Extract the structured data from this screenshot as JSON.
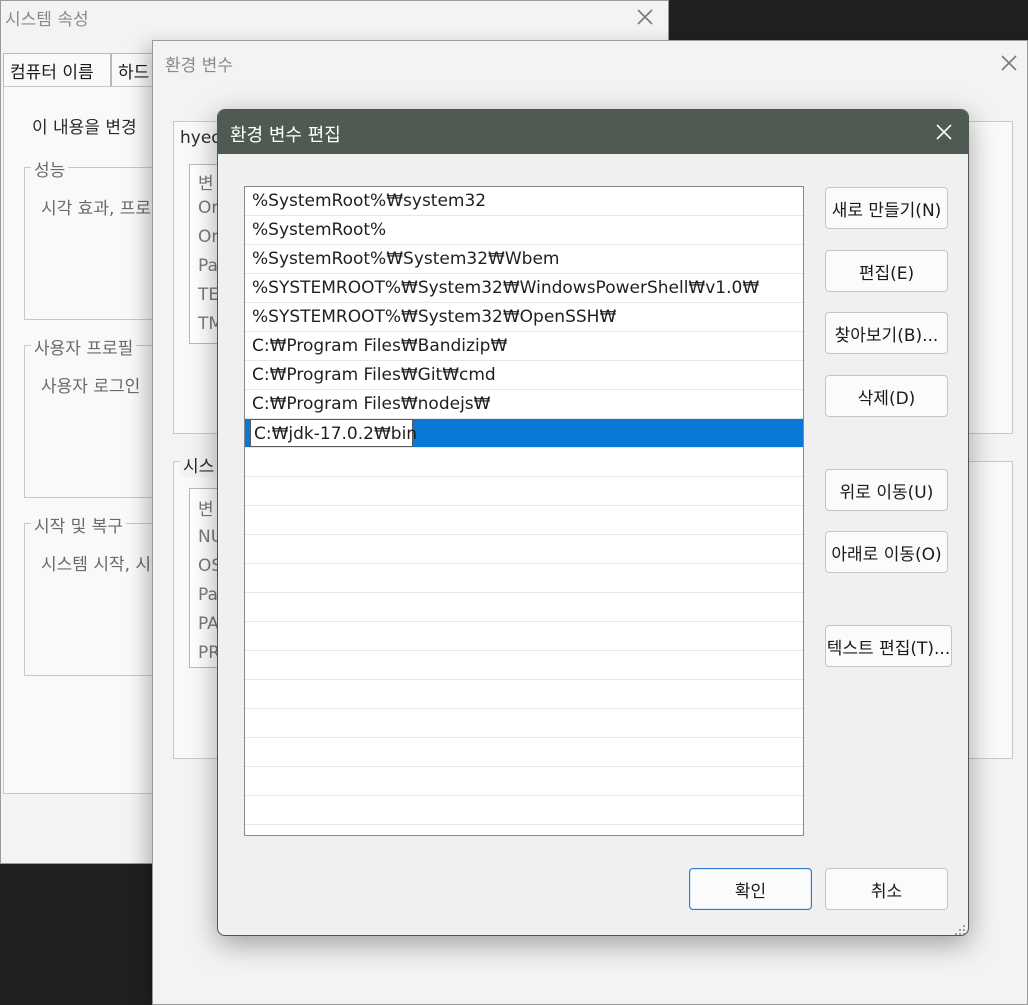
{
  "system_properties": {
    "title": "시스템 속성",
    "tabs": [
      "컴퓨터 이름",
      "하드"
    ],
    "intro_text": "이 내용을 변경",
    "groups": [
      {
        "legend": "성능",
        "text": "시각 효과, 프로"
      },
      {
        "legend": "사용자 프로필",
        "text": "사용자 로그인"
      },
      {
        "legend": "시작 및 복구",
        "text": "시스템 시작, 시"
      }
    ]
  },
  "env_variables": {
    "title": "환경 변수",
    "user_section_label": "hyeo",
    "user_list_header": "변",
    "user_rows": [
      "On",
      "On",
      "Pa",
      "TE",
      "TM"
    ],
    "system_section_label": "시스",
    "system_list_header": "변",
    "system_rows": [
      "NU",
      "OS",
      "Pa",
      "PA",
      "PR"
    ]
  },
  "edit_dialog": {
    "title": "환경 변수 편집",
    "paths": [
      "%SystemRoot%₩system32",
      "%SystemRoot%",
      "%SystemRoot%₩System32₩Wbem",
      "%SYSTEMROOT%₩System32₩WindowsPowerShell₩v1.0₩",
      "%SYSTEMROOT%₩System32₩OpenSSH₩",
      "C:₩Program Files₩Bandizip₩",
      "C:₩Program Files₩Git₩cmd",
      "C:₩Program Files₩nodejs₩"
    ],
    "editing_value": "C:₩jdk-17.0.2₩bin",
    "buttons": {
      "new": "새로 만들기(N)",
      "edit": "편집(E)",
      "browse": "찾아보기(B)...",
      "delete": "삭제(D)",
      "move_up": "위로 이동(U)",
      "move_down": "아래로 이동(O)",
      "edit_text": "텍스트 편집(T)...",
      "ok": "확인",
      "cancel": "취소"
    }
  },
  "colors": {
    "edit_titlebar": "#4f5b52",
    "selection": "#0a78d7",
    "primary_border": "#2a7bd6"
  }
}
